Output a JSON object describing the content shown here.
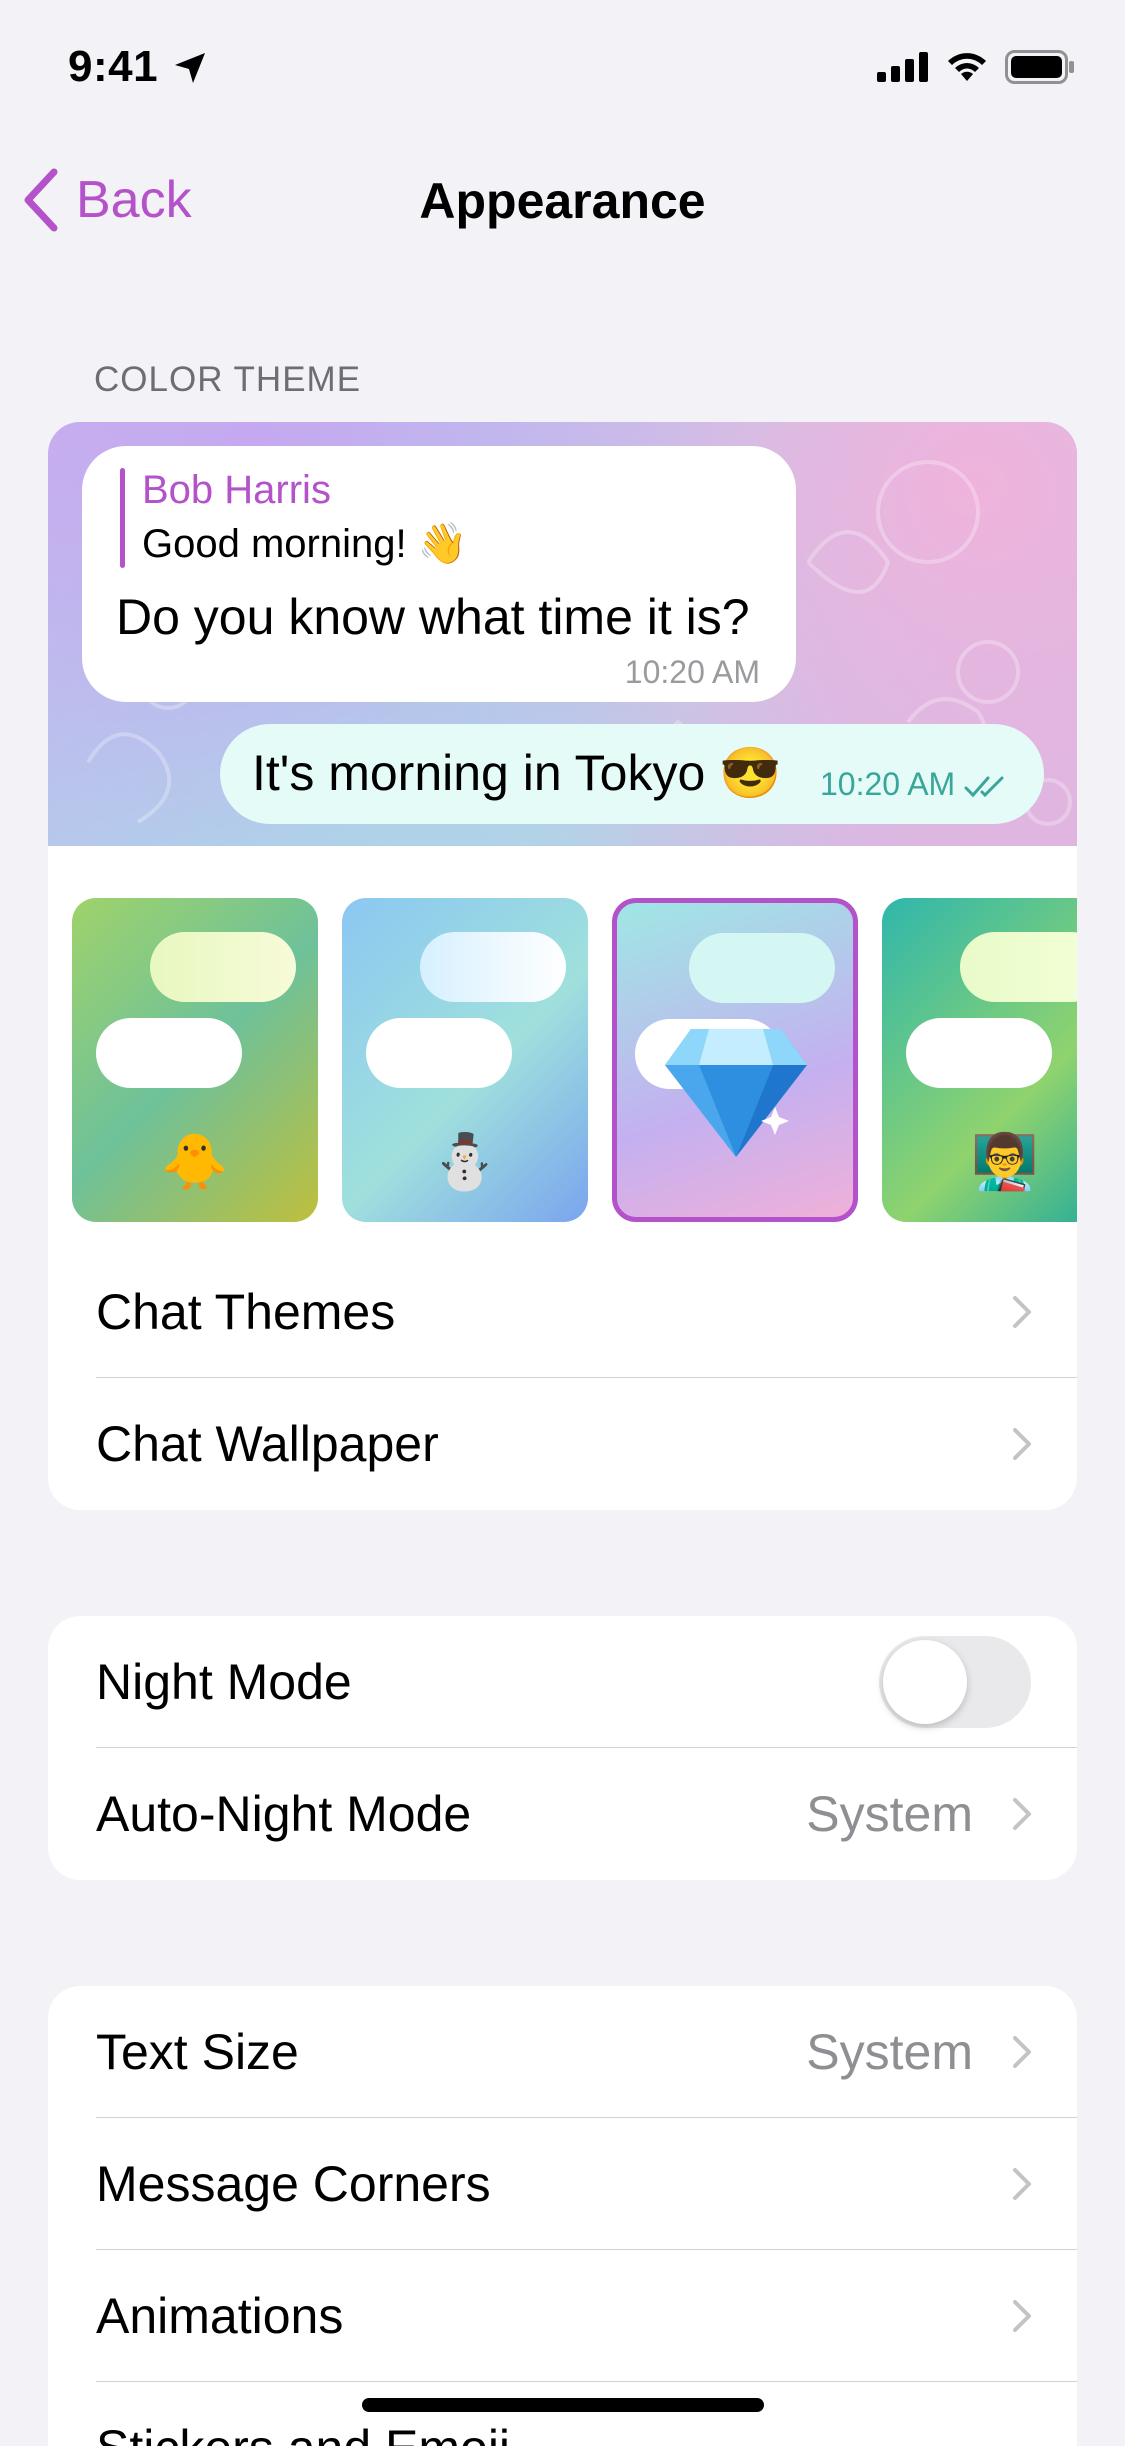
{
  "status_bar": {
    "time": "9:41"
  },
  "nav": {
    "back_label": "Back",
    "title": "Appearance"
  },
  "color_theme": {
    "section_title": "COLOR THEME",
    "preview": {
      "reply_name": "Bob Harris",
      "reply_text": "Good morning! 👋",
      "incoming_text": "Do you know what time it is?",
      "incoming_time": "10:20 AM",
      "outgoing_text": "It's morning in Tokyo 😎",
      "outgoing_time": "10:20 AM"
    },
    "themes": [
      {
        "emoji": "🐥",
        "selected": false
      },
      {
        "emoji": "⛄",
        "selected": false
      },
      {
        "emoji": "💎",
        "selected": true
      },
      {
        "emoji": "👨‍🏫",
        "selected": false
      }
    ],
    "rows": [
      {
        "label": "Chat Themes"
      },
      {
        "label": "Chat Wallpaper"
      }
    ]
  },
  "night": {
    "night_mode_label": "Night Mode",
    "night_mode_on": false,
    "auto_night_label": "Auto-Night Mode",
    "auto_night_value": "System"
  },
  "display": {
    "rows": [
      {
        "label": "Text Size",
        "value": "System"
      },
      {
        "label": "Message Corners",
        "value": ""
      },
      {
        "label": "Animations",
        "value": ""
      },
      {
        "label": "Stickers and Emoji",
        "value": ""
      }
    ]
  },
  "colors": {
    "accent": "#b452c9",
    "background": "#f2f2f7",
    "secondary_text": "#8e8e93"
  }
}
